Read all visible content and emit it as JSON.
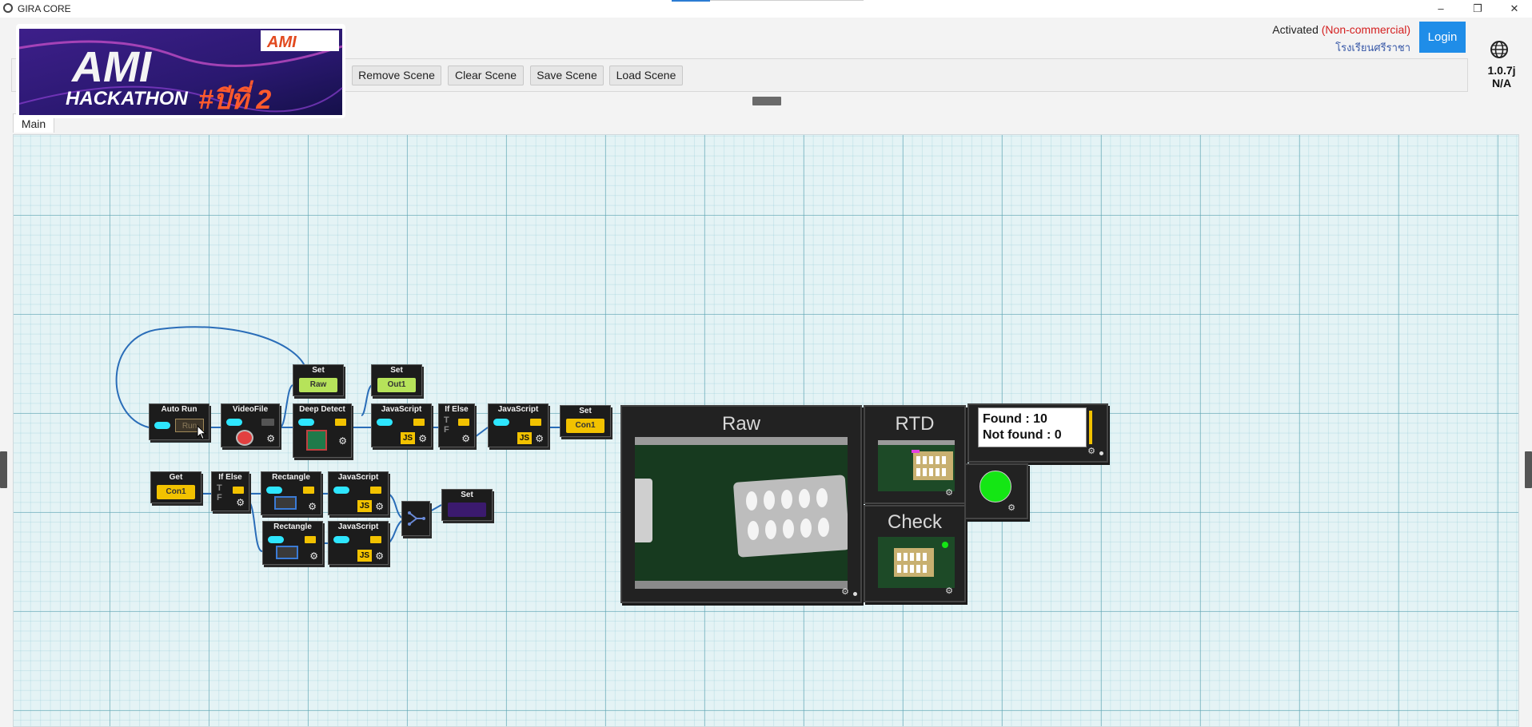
{
  "window": {
    "title": "GIRA CORE",
    "controls": {
      "minimize": "–",
      "maximize": "❐",
      "close": "✕"
    }
  },
  "banner": {
    "brand": "AMI",
    "line1": "AMI",
    "line2": "HACKATHON",
    "line3": "#ปีที่ 2"
  },
  "toolbar": {
    "remove_scene": "Remove Scene",
    "clear_scene": "Clear Scene",
    "save_scene": "Save Scene",
    "load_scene": "Load Scene"
  },
  "license": {
    "activated": "Activated",
    "noncommercial": "(Non-commercial)",
    "school": "โรงเรียนศรีราชา",
    "login": "Login",
    "version": "1.0.7j",
    "status": "N/A"
  },
  "tabs": {
    "main": "Main"
  },
  "nodes": {
    "auto_run": {
      "title": "Auto Run",
      "button": "Run"
    },
    "video_file": {
      "title": "VideoFile"
    },
    "set_raw": {
      "title": "Set",
      "value": "Raw"
    },
    "set_out1": {
      "title": "Set",
      "value": "Out1"
    },
    "deep_detect": {
      "title": "Deep Detect"
    },
    "javascript1": {
      "title": "JavaScript",
      "badge": "JS"
    },
    "if_else1": {
      "title": "If Else",
      "t": "T",
      "f": "F"
    },
    "javascript2": {
      "title": "JavaScript",
      "badge": "JS"
    },
    "set_con1": {
      "title": "Set",
      "value": "Con1"
    },
    "get_con1": {
      "title": "Get",
      "value": "Con1"
    },
    "if_else2": {
      "title": "If Else",
      "t": "T",
      "f": "F"
    },
    "rectangle1": {
      "title": "Rectangle"
    },
    "javascript3": {
      "title": "JavaScript",
      "badge": "JS"
    },
    "rectangle2": {
      "title": "Rectangle"
    },
    "javascript4": {
      "title": "JavaScript",
      "badge": "JS"
    },
    "set_bottom": {
      "title": "Set"
    }
  },
  "viewers": {
    "raw": "Raw",
    "rtd": "RTD",
    "check": "Check",
    "found": "Found : 10",
    "not_found": "Not found : 0"
  },
  "colors": {
    "accent": "#1f8de8",
    "noncommercial": "#d42020",
    "toggle": "#2ee6ff",
    "node_yellow": "#f2c200",
    "node_green": "#b6e35a",
    "status_green": "#14e614",
    "wire": "#2a6db8"
  },
  "icons": [
    "app-icon",
    "globe-icon",
    "gear-icon",
    "cursor-icon"
  ]
}
